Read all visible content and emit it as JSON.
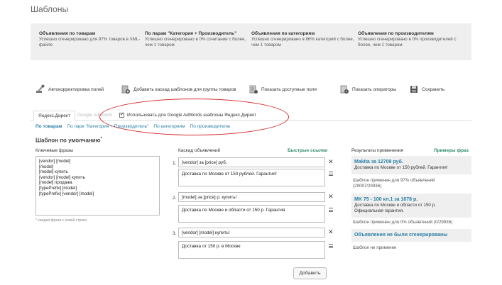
{
  "page": {
    "title": "Шаблоны"
  },
  "summary": [
    {
      "title": "Объявления по товарам",
      "text": "Успешно сгенерировано для 97% товаров в XML-файле"
    },
    {
      "title": "По парам \"Категория + Производитель\"",
      "text": "Успешно сгенерировано в 0% сочетании с более, чем 1 товаром"
    },
    {
      "title": "Объявления по категориям",
      "text": "Успешно сгенерировано в 86% категорий с более, чем 1 товаром"
    },
    {
      "title": "Объявления по производителям",
      "text": "Успешно сгенерировано в 0% производителей с более, чем 1 товаром"
    }
  ],
  "toolbar": {
    "autocorrect": "Автокорректировка полей",
    "add_cascade": "Добавить каскад шаблонов для группы товаров",
    "show_fields": "Показать доступные поля",
    "show_operators": "Показать операторы",
    "save": "Сохранить"
  },
  "tabs": {
    "yandex": "Яндекс.Директ",
    "google": "Google AdWords"
  },
  "checkbox_label": "Использовать для Google AdWords шаблоны Яндекс.Директ",
  "subnav": [
    "По товарам",
    "По паре \"Категория + Производитель\"",
    "По категориям",
    "По производителю"
  ],
  "section": {
    "title": "Шаблон по умолчанию",
    "mark": "*"
  },
  "columns": {
    "phrases": "Ключевые фразы",
    "cascade": "Каскад объявлений",
    "quick_links": "Быстрые ссылки",
    "results": "Результаты применения",
    "examples": "Примеры фраз"
  },
  "phrases": [
    "[vendor] [model]",
    "[model]",
    "[model] купить",
    "[vendor] [model] купить",
    "[model] продажа",
    "[typePrefix] [model]",
    "[typePrefix] [vendor] [model]"
  ],
  "phrases_note": "* каждая фраза с новой строки",
  "ads": [
    {
      "num": "1.",
      "title": "[vendor] за [price] руб.",
      "text": "Доставка по Москве от 150 рублей.  Гарантия!"
    },
    {
      "num": "2.",
      "title": "[model] за [price] р. купить!",
      "text": "Доставка по Москве и области от 150 р. Гарантия"
    },
    {
      "num": "3.",
      "title": "[vendor] [model]  купить!",
      "text": "Доставка от 150 р. в Москве"
    }
  ],
  "add_button": "Добавить",
  "results": [
    {
      "title": "Makita за 12709 руб.",
      "text": "Доставка по Москве от 150 рублей. Гарантия!",
      "applied": "Шаблон применен для 97% объявлений (29097/29936)"
    },
    {
      "title": "MK 75 - 100 кл.1 за 1678 р.",
      "text": "Доставка по Москве и области от 150 р. Официальная гарантия.",
      "applied": "Шаблон применен для 0% объявлений (0/29936)"
    },
    {
      "title": "Объявления не были сгенерированы",
      "text": "",
      "applied": "Шаблон не применен"
    }
  ]
}
